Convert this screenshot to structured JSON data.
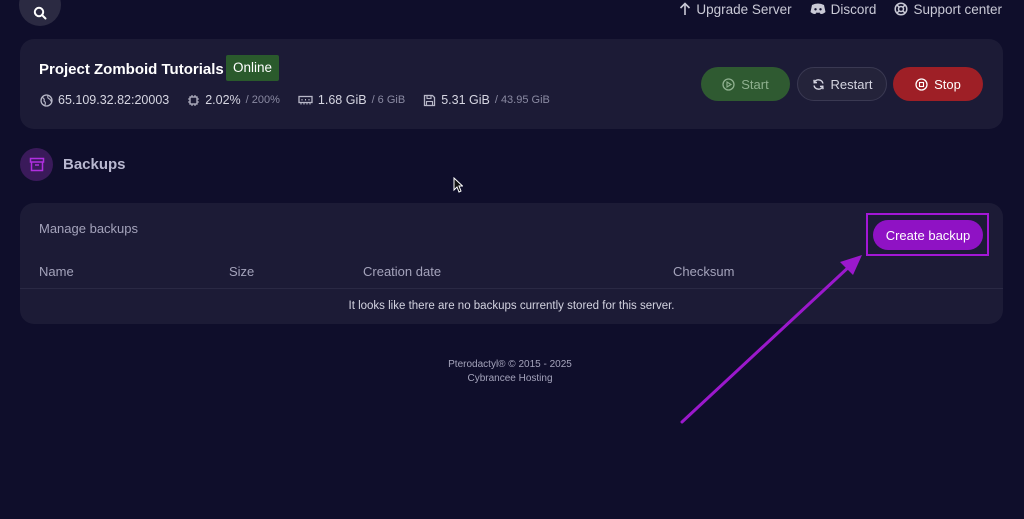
{
  "topnav": {
    "items": [
      {
        "label": "Upgrade Server",
        "icon": "arrow-up-icon"
      },
      {
        "label": "Discord",
        "icon": "discord-icon"
      },
      {
        "label": "Support center",
        "icon": "lifebuoy-icon"
      }
    ]
  },
  "server": {
    "name": "Project Zomboid Tutorials",
    "status": "Online",
    "address": "65.109.32.82:20003",
    "cpu": "2.02%",
    "cpu_limit": "/ 200%",
    "memory": "1.68 GiB",
    "memory_limit": "/ 6 GiB",
    "disk": "5.31 GiB",
    "disk_limit": "/ 43.95 GiB",
    "buttons": {
      "start": "Start",
      "restart": "Restart",
      "stop": "Stop"
    }
  },
  "section": {
    "title": "Backups"
  },
  "backups": {
    "manage_label": "Manage backups",
    "create_button": "Create backup",
    "columns": [
      "Name",
      "Size",
      "Creation date",
      "Checksum"
    ],
    "empty_message": "It looks like there are no backups currently stored for this server."
  },
  "footer": {
    "line1": "Pterodactyl® © 2015 - 2025",
    "line2": "Cybrancee Hosting"
  },
  "colors": {
    "background": "#0f0e2b",
    "card": "#1c1b36",
    "accent": "#8f12c4",
    "online": "#2a5a2c",
    "stop": "#9e1f26"
  }
}
